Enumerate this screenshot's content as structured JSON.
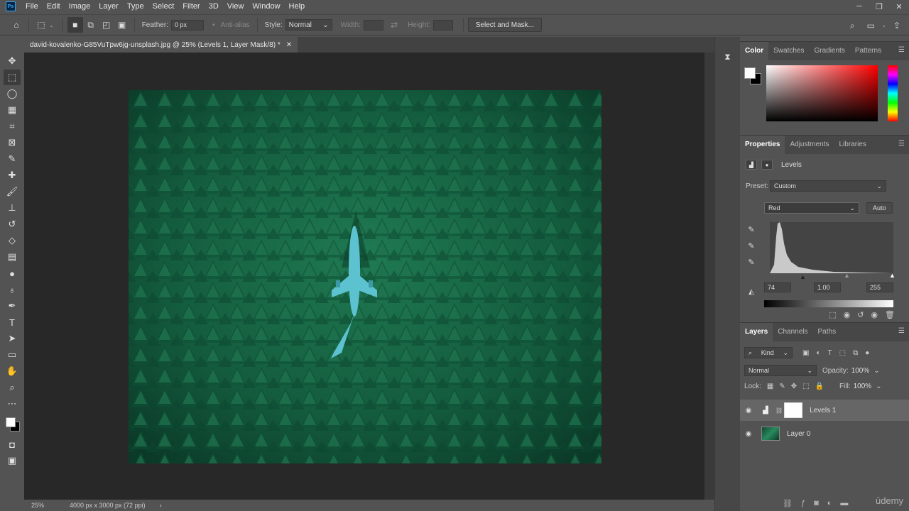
{
  "app": {
    "logo": "Ps"
  },
  "menu": [
    "File",
    "Edit",
    "Image",
    "Layer",
    "Type",
    "Select",
    "Filter",
    "3D",
    "View",
    "Window",
    "Help"
  ],
  "options": {
    "feather_label": "Feather:",
    "feather_value": "0 px",
    "antialias_label": "Anti-alias",
    "style_label": "Style:",
    "style_value": "Normal",
    "width_label": "Width:",
    "height_label": "Height:",
    "select_mask_button": "Select and Mask..."
  },
  "document": {
    "tab_title": "david-kovalenko-G85VuTpw6jg-unsplash.jpg @ 25% (Levels 1, Layer Mask/8) *"
  },
  "status": {
    "zoom": "25%",
    "doc_info": "4000 px x 3000 px (72 ppi)"
  },
  "color_panel": {
    "tabs": [
      "Color",
      "Swatches",
      "Gradients",
      "Patterns"
    ],
    "fg": "#ffffff",
    "bg": "#000000"
  },
  "properties": {
    "tabs": [
      "Properties",
      "Adjustments",
      "Libraries"
    ],
    "title": "Levels",
    "preset_label": "Preset:",
    "preset_value": "Custom",
    "channel_value": "Red",
    "auto_button": "Auto",
    "input_black": "74",
    "input_gamma": "1.00",
    "input_white": "255"
  },
  "layers": {
    "tabs": [
      "Layers",
      "Channels",
      "Paths"
    ],
    "filter_kind": "Kind",
    "blend_mode": "Normal",
    "opacity_label": "Opacity:",
    "opacity_value": "100%",
    "lock_label": "Lock:",
    "fill_label": "Fill:",
    "fill_value": "100%",
    "items": [
      {
        "name": "Levels 1"
      },
      {
        "name": "Layer 0"
      }
    ]
  },
  "watermark": "ūdemy"
}
